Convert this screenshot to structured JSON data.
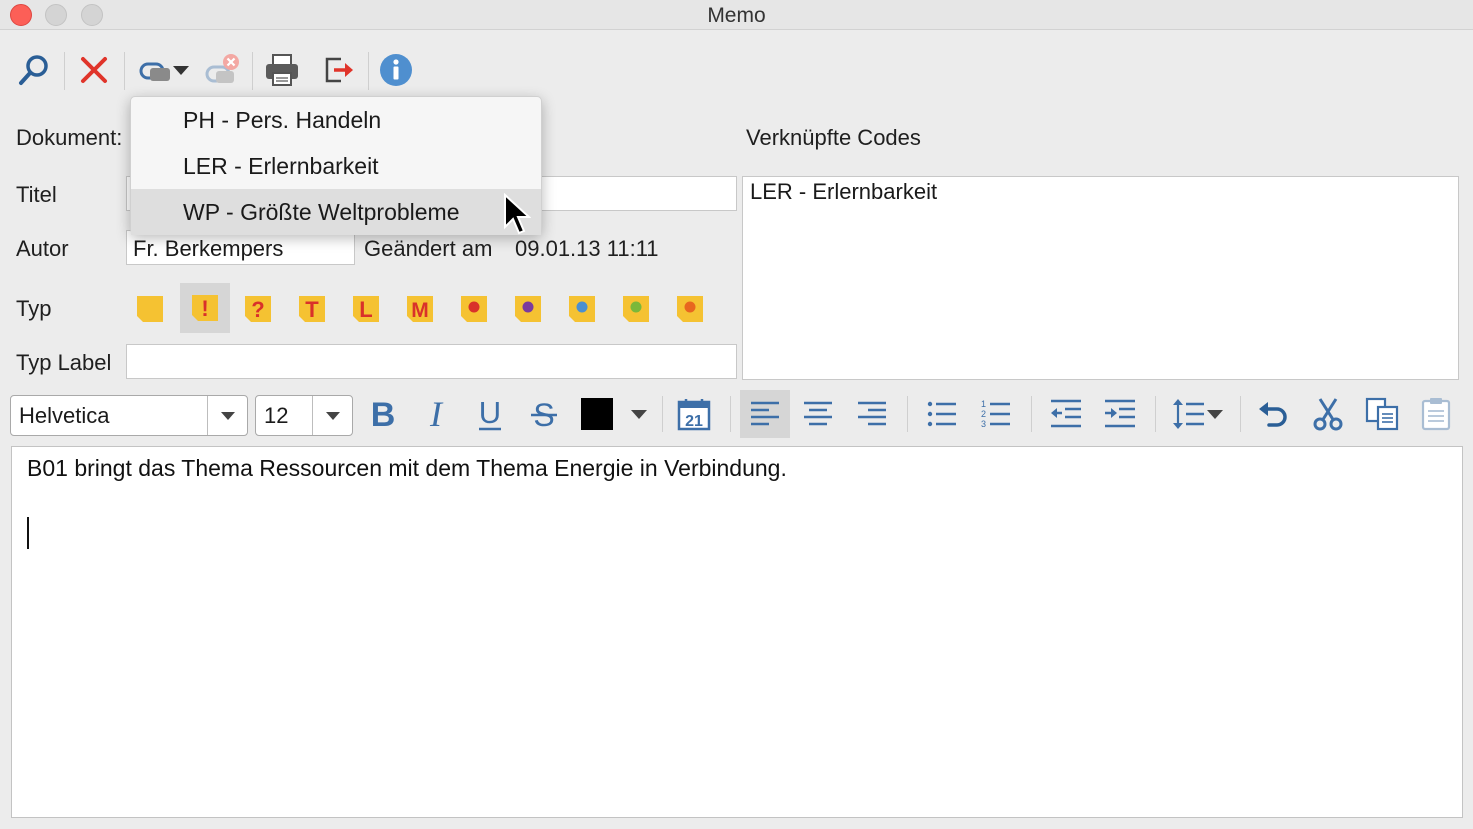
{
  "window": {
    "title": "Memo"
  },
  "toolbar": {
    "icons": [
      "search-icon",
      "delete-icon",
      "link-code-icon",
      "dropdown-arrow-icon",
      "unlink-code-icon",
      "print-icon",
      "export-icon",
      "info-icon"
    ]
  },
  "form": {
    "dokument_label": "Dokument:",
    "titel_label": "Titel",
    "autor_label": "Autor",
    "autor_value": "Fr. Berkempers",
    "changed_label": "Geändert am",
    "changed_value": "09.01.13 11:11",
    "typ_label": "Typ",
    "typ_label_label": "Typ Label",
    "typ_icons": [
      "",
      "!",
      "?",
      "T",
      "L",
      "M",
      "",
      "",
      "",
      "",
      ""
    ]
  },
  "linked_codes": {
    "label": "Verknüpfte Codes",
    "items": [
      "LER - Erlernbarkeit"
    ]
  },
  "menu": {
    "items": [
      "PH - Pers. Handeln",
      "LER - Erlernbarkeit",
      "WP - Größte Weltprobleme"
    ],
    "highlighted_index": 2
  },
  "format": {
    "font": "Helvetica",
    "size": "12",
    "color": "#000000"
  },
  "editor": {
    "text": "B01 bringt das Thema Ressourcen mit dem Thema Energie in Verbindung."
  },
  "colors": {
    "memo_yellow": "#f5c232",
    "icon_blue": "#3d6fa8",
    "delete_red": "#e0342a"
  }
}
